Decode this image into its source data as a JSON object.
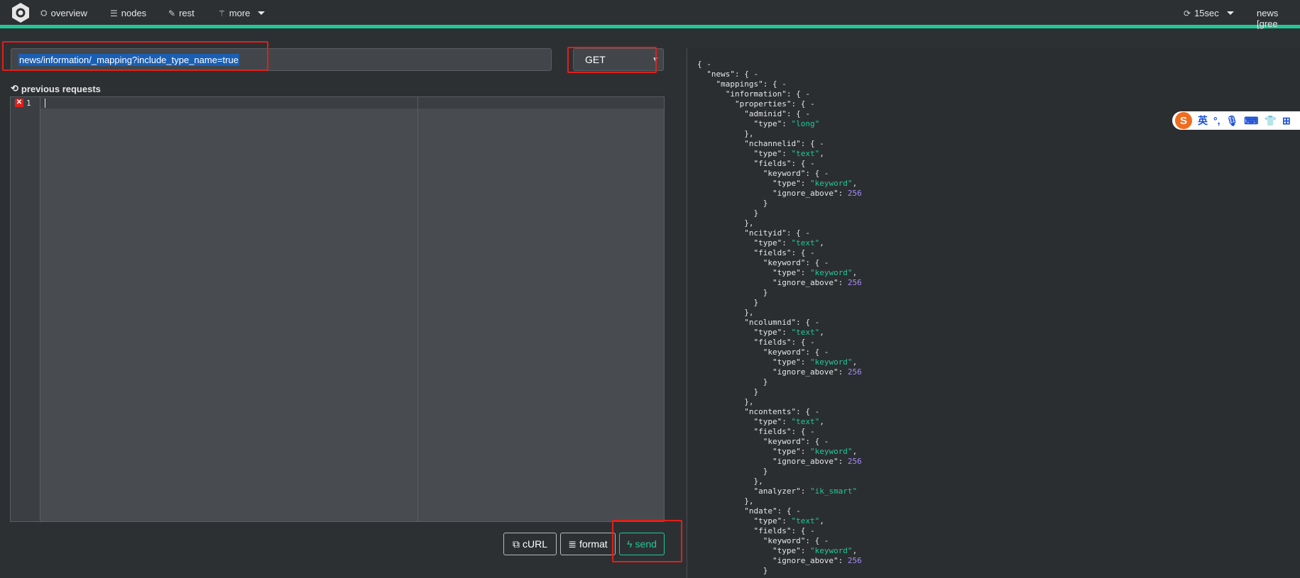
{
  "nav": {
    "items": [
      {
        "label": "overview",
        "icon": "sitemap-icon"
      },
      {
        "label": "nodes",
        "icon": "server-icon"
      },
      {
        "label": "rest",
        "icon": "edit-icon"
      },
      {
        "label": "more",
        "icon": "magic-icon"
      }
    ],
    "refresh_label": "15sec",
    "cluster_label": "news [gree"
  },
  "request": {
    "path": "news/information/_mapping?include_type_name=true",
    "method": "GET",
    "previous_requests_label": "previous requests",
    "line_number": "1"
  },
  "buttons": {
    "curl": "cURL",
    "format": "format",
    "send": "send"
  },
  "ime": {
    "lang": "英",
    "punct": "°,"
  },
  "colors": {
    "accent": "#20c997",
    "highlight_box": "#e0201a",
    "string": "#20c997",
    "number": "#a78bfa"
  }
}
